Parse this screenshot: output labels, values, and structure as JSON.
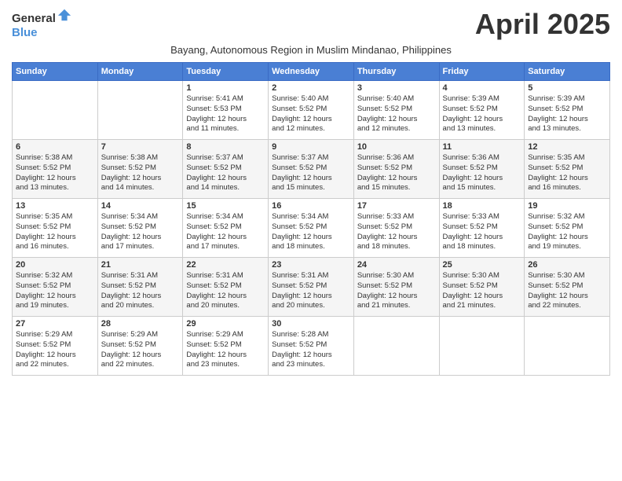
{
  "header": {
    "logo_general": "General",
    "logo_blue": "Blue",
    "month_title": "April 2025",
    "subtitle": "Bayang, Autonomous Region in Muslim Mindanao, Philippines"
  },
  "days_of_week": [
    "Sunday",
    "Monday",
    "Tuesday",
    "Wednesday",
    "Thursday",
    "Friday",
    "Saturday"
  ],
  "weeks": [
    [
      {
        "day": "",
        "info": ""
      },
      {
        "day": "",
        "info": ""
      },
      {
        "day": "1",
        "info": "Sunrise: 5:41 AM\nSunset: 5:53 PM\nDaylight: 12 hours\nand 11 minutes."
      },
      {
        "day": "2",
        "info": "Sunrise: 5:40 AM\nSunset: 5:52 PM\nDaylight: 12 hours\nand 12 minutes."
      },
      {
        "day": "3",
        "info": "Sunrise: 5:40 AM\nSunset: 5:52 PM\nDaylight: 12 hours\nand 12 minutes."
      },
      {
        "day": "4",
        "info": "Sunrise: 5:39 AM\nSunset: 5:52 PM\nDaylight: 12 hours\nand 13 minutes."
      },
      {
        "day": "5",
        "info": "Sunrise: 5:39 AM\nSunset: 5:52 PM\nDaylight: 12 hours\nand 13 minutes."
      }
    ],
    [
      {
        "day": "6",
        "info": "Sunrise: 5:38 AM\nSunset: 5:52 PM\nDaylight: 12 hours\nand 13 minutes."
      },
      {
        "day": "7",
        "info": "Sunrise: 5:38 AM\nSunset: 5:52 PM\nDaylight: 12 hours\nand 14 minutes."
      },
      {
        "day": "8",
        "info": "Sunrise: 5:37 AM\nSunset: 5:52 PM\nDaylight: 12 hours\nand 14 minutes."
      },
      {
        "day": "9",
        "info": "Sunrise: 5:37 AM\nSunset: 5:52 PM\nDaylight: 12 hours\nand 15 minutes."
      },
      {
        "day": "10",
        "info": "Sunrise: 5:36 AM\nSunset: 5:52 PM\nDaylight: 12 hours\nand 15 minutes."
      },
      {
        "day": "11",
        "info": "Sunrise: 5:36 AM\nSunset: 5:52 PM\nDaylight: 12 hours\nand 15 minutes."
      },
      {
        "day": "12",
        "info": "Sunrise: 5:35 AM\nSunset: 5:52 PM\nDaylight: 12 hours\nand 16 minutes."
      }
    ],
    [
      {
        "day": "13",
        "info": "Sunrise: 5:35 AM\nSunset: 5:52 PM\nDaylight: 12 hours\nand 16 minutes."
      },
      {
        "day": "14",
        "info": "Sunrise: 5:34 AM\nSunset: 5:52 PM\nDaylight: 12 hours\nand 17 minutes."
      },
      {
        "day": "15",
        "info": "Sunrise: 5:34 AM\nSunset: 5:52 PM\nDaylight: 12 hours\nand 17 minutes."
      },
      {
        "day": "16",
        "info": "Sunrise: 5:34 AM\nSunset: 5:52 PM\nDaylight: 12 hours\nand 18 minutes."
      },
      {
        "day": "17",
        "info": "Sunrise: 5:33 AM\nSunset: 5:52 PM\nDaylight: 12 hours\nand 18 minutes."
      },
      {
        "day": "18",
        "info": "Sunrise: 5:33 AM\nSunset: 5:52 PM\nDaylight: 12 hours\nand 18 minutes."
      },
      {
        "day": "19",
        "info": "Sunrise: 5:32 AM\nSunset: 5:52 PM\nDaylight: 12 hours\nand 19 minutes."
      }
    ],
    [
      {
        "day": "20",
        "info": "Sunrise: 5:32 AM\nSunset: 5:52 PM\nDaylight: 12 hours\nand 19 minutes."
      },
      {
        "day": "21",
        "info": "Sunrise: 5:31 AM\nSunset: 5:52 PM\nDaylight: 12 hours\nand 20 minutes."
      },
      {
        "day": "22",
        "info": "Sunrise: 5:31 AM\nSunset: 5:52 PM\nDaylight: 12 hours\nand 20 minutes."
      },
      {
        "day": "23",
        "info": "Sunrise: 5:31 AM\nSunset: 5:52 PM\nDaylight: 12 hours\nand 20 minutes."
      },
      {
        "day": "24",
        "info": "Sunrise: 5:30 AM\nSunset: 5:52 PM\nDaylight: 12 hours\nand 21 minutes."
      },
      {
        "day": "25",
        "info": "Sunrise: 5:30 AM\nSunset: 5:52 PM\nDaylight: 12 hours\nand 21 minutes."
      },
      {
        "day": "26",
        "info": "Sunrise: 5:30 AM\nSunset: 5:52 PM\nDaylight: 12 hours\nand 22 minutes."
      }
    ],
    [
      {
        "day": "27",
        "info": "Sunrise: 5:29 AM\nSunset: 5:52 PM\nDaylight: 12 hours\nand 22 minutes."
      },
      {
        "day": "28",
        "info": "Sunrise: 5:29 AM\nSunset: 5:52 PM\nDaylight: 12 hours\nand 22 minutes."
      },
      {
        "day": "29",
        "info": "Sunrise: 5:29 AM\nSunset: 5:52 PM\nDaylight: 12 hours\nand 23 minutes."
      },
      {
        "day": "30",
        "info": "Sunrise: 5:28 AM\nSunset: 5:52 PM\nDaylight: 12 hours\nand 23 minutes."
      },
      {
        "day": "",
        "info": ""
      },
      {
        "day": "",
        "info": ""
      },
      {
        "day": "",
        "info": ""
      }
    ]
  ]
}
